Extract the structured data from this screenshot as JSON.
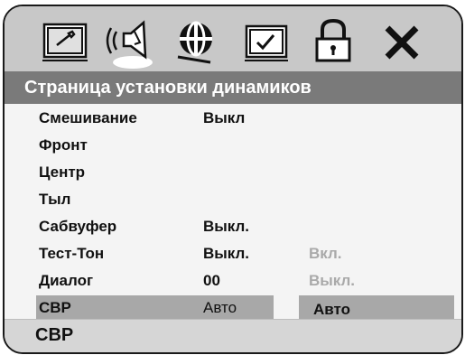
{
  "toolbar": {
    "icons": [
      {
        "name": "general-setup-icon"
      },
      {
        "name": "speaker-setup-icon"
      },
      {
        "name": "audio-setup-icon"
      },
      {
        "name": "video-setup-icon"
      },
      {
        "name": "lock-icon"
      },
      {
        "name": "exit-icon"
      }
    ]
  },
  "page": {
    "title": "Страница установки динамиков"
  },
  "settings": [
    {
      "label": "Смешивание",
      "value": "Выкл",
      "option": ""
    },
    {
      "label": "Фронт",
      "value": "",
      "option": ""
    },
    {
      "label": "Центр",
      "value": "",
      "option": ""
    },
    {
      "label": "Тыл",
      "value": "",
      "option": ""
    },
    {
      "label": "Сабвуфер",
      "value": "Выкл.",
      "option": ""
    },
    {
      "label": "Тест-Тон",
      "value": "Выкл.",
      "option": "Вкл."
    },
    {
      "label": "Диалог",
      "value": "00",
      "option": "Выкл."
    },
    {
      "label": "CBP",
      "value": "Авто",
      "option": "Авто"
    }
  ],
  "status": {
    "text": "CBP"
  },
  "colors": {
    "title_bar": "#7a7a7a",
    "toolbar": "#c8c8c8",
    "selection": "#a8a8a8",
    "inactive_option": "#a9a9a9"
  }
}
